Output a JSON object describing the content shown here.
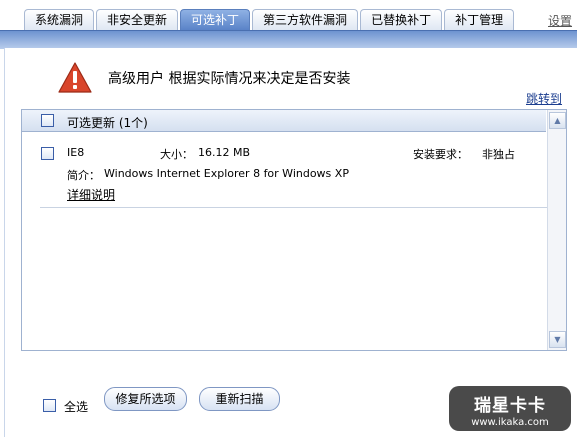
{
  "tabs": [
    {
      "label": "系统漏洞",
      "active": false
    },
    {
      "label": "非安全更新",
      "active": false
    },
    {
      "label": "可选补丁",
      "active": true
    },
    {
      "label": "第三方软件漏洞",
      "active": false
    },
    {
      "label": "已替换补丁",
      "active": false
    },
    {
      "label": "补丁管理",
      "active": false
    }
  ],
  "settings_label": "设置",
  "warning": {
    "icon": "warning-triangle-icon",
    "text": "高级用户  根据实际情况来决定是否安装"
  },
  "jump_label": "跳转到",
  "list": {
    "header": "可选更新 (1个)",
    "item": {
      "name": "IE8",
      "size_label": "大小：",
      "size_value": "16.12 MB",
      "req_label": "安装要求：",
      "req_value": "非独占",
      "desc_label": "简介：",
      "desc_value": "Windows Internet Explorer 8 for Windows XP",
      "detail_label": "详细说明"
    }
  },
  "bottom": {
    "select_all": "全选",
    "repair_button": "修复所选项",
    "rescan_button": "重新扫描"
  },
  "watermark": {
    "title": "瑞星卡卡",
    "url": "www.ikaka.com"
  },
  "colors": {
    "accent": "#5a83c8",
    "warning": "#d9452b"
  }
}
